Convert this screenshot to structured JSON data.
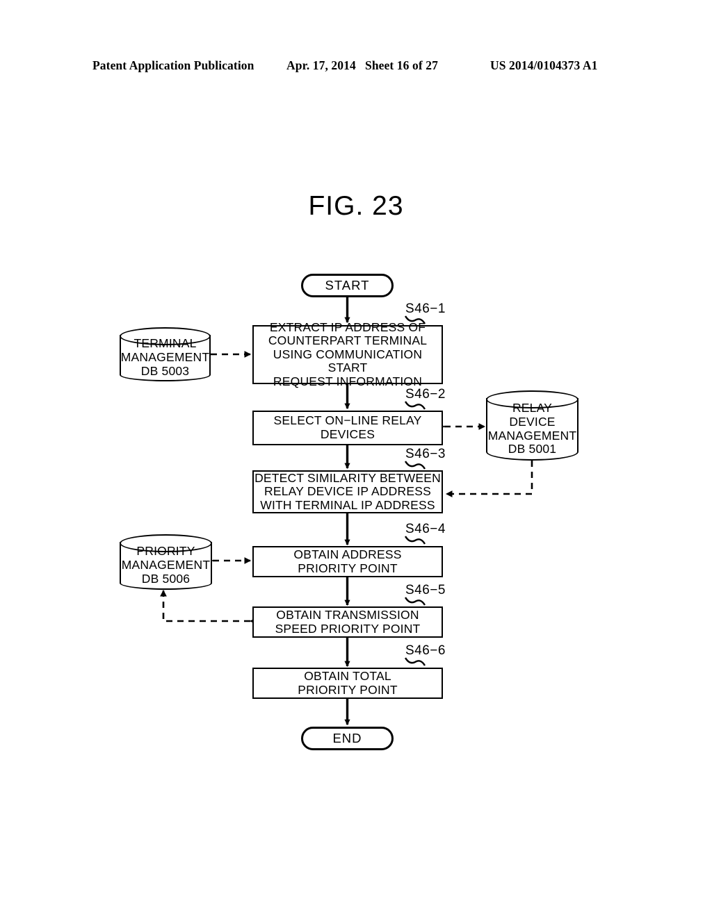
{
  "header": {
    "publication": "Patent Application Publication",
    "date": "Apr. 17, 2014",
    "sheet": "Sheet 16 of 27",
    "number": "US 2014/0104373 A1"
  },
  "figure": {
    "title": "FIG. 23"
  },
  "flowchart": {
    "start_label": "START",
    "end_label": "END",
    "steps": [
      {
        "id": "S46-1",
        "text": "EXTRACT IP ADDRESS OF\nCOUNTERPART TERMINAL\nUSING COMMUNICATION START\nREQUEST INFORMATION"
      },
      {
        "id": "S46-2",
        "text": "SELECT ON−LINE RELAY\nDEVICES"
      },
      {
        "id": "S46-3",
        "text": "DETECT SIMILARITY BETWEEN\nRELAY DEVICE IP ADDRESS\nWITH TERMINAL IP ADDRESS"
      },
      {
        "id": "S46-4",
        "text": "OBTAIN ADDRESS\nPRIORITY POINT"
      },
      {
        "id": "S46-5",
        "text": "OBTAIN TRANSMISSION\nSPEED PRIORITY POINT"
      },
      {
        "id": "S46-6",
        "text": "OBTAIN TOTAL\nPRIORITY POINT"
      }
    ],
    "step_labels": {
      "s1": "S46−1",
      "s2": "S46−2",
      "s3": "S46−3",
      "s4": "S46−4",
      "s5": "S46−5",
      "s6": "S46−6"
    },
    "databases": [
      {
        "key": "terminal",
        "text": "TERMINAL\nMANAGEMENT\nDB 5003"
      },
      {
        "key": "relay",
        "text": "RELAY\nDEVICE\nMANAGEMENT\nDB 5001"
      },
      {
        "key": "priority",
        "text": "PRIORITY\nMANAGEMENT\nDB 5006"
      }
    ]
  },
  "colors": {
    "ink": "#000000",
    "paper": "#ffffff"
  }
}
